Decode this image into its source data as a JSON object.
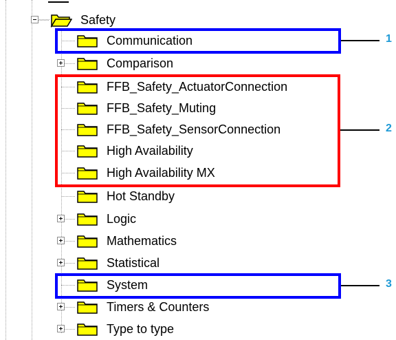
{
  "tree": {
    "root": {
      "label": "Safety",
      "expander": "minus",
      "icon": "open-folder-icon"
    },
    "items": [
      {
        "label": "Communication",
        "expander": "none",
        "icon": "folder-icon"
      },
      {
        "label": "Comparison",
        "expander": "plus",
        "icon": "folder-icon"
      },
      {
        "label": "FFB_Safety_ActuatorConnection",
        "expander": "none",
        "icon": "folder-icon"
      },
      {
        "label": "FFB_Safety_Muting",
        "expander": "none",
        "icon": "folder-icon"
      },
      {
        "label": "FFB_Safety_SensorConnection",
        "expander": "none",
        "icon": "folder-icon"
      },
      {
        "label": "High Availability",
        "expander": "none",
        "icon": "folder-icon"
      },
      {
        "label": "High Availability MX",
        "expander": "none",
        "icon": "folder-icon"
      },
      {
        "label": "Hot Standby",
        "expander": "none",
        "icon": "folder-icon"
      },
      {
        "label": "Logic",
        "expander": "plus",
        "icon": "folder-icon"
      },
      {
        "label": "Mathematics",
        "expander": "plus",
        "icon": "folder-icon"
      },
      {
        "label": "Statistical",
        "expander": "plus",
        "icon": "folder-icon"
      },
      {
        "label": "System",
        "expander": "none",
        "icon": "folder-icon"
      },
      {
        "label": "Timers & Counters",
        "expander": "plus",
        "icon": "folder-icon"
      },
      {
        "label": "Type to type",
        "expander": "plus",
        "icon": "folder-icon"
      }
    ]
  },
  "callouts": [
    {
      "number": "1",
      "color": "#0000ff"
    },
    {
      "number": "2",
      "color": "#ff0000"
    },
    {
      "number": "3",
      "color": "#0000ff"
    }
  ],
  "colors": {
    "folder": "#ffff00",
    "callout_number": "#1e9ad6"
  }
}
